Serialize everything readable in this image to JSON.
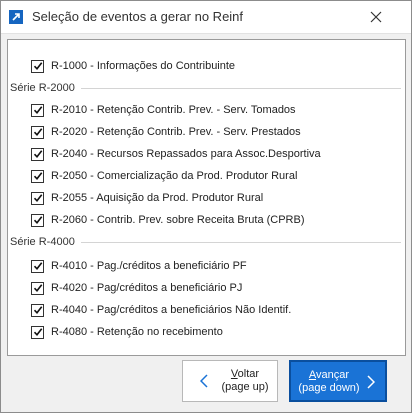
{
  "window": {
    "title": "Seleção de eventos a gerar no Reinf"
  },
  "events": {
    "r1000": {
      "label": "R-1000 - Informações do Contribuinte",
      "checked": true
    },
    "serie2000": {
      "label": "Série R-2000",
      "items": [
        {
          "label": "R-2010 - Retenção Contrib. Prev. - Serv. Tomados",
          "checked": true
        },
        {
          "label": "R-2020 - Retenção Contrib. Prev. - Serv. Prestados",
          "checked": true
        },
        {
          "label": "R-2040 - Recursos Repassados para Assoc.Desportiva",
          "checked": true
        },
        {
          "label": "R-2050 - Comercialização da Prod. Produtor Rural",
          "checked": true
        },
        {
          "label": "R-2055 - Aquisição da Prod. Produtor Rural",
          "checked": true
        },
        {
          "label": "R-2060 - Contrib. Prev. sobre Receita Bruta (CPRB)",
          "checked": true
        }
      ]
    },
    "serie4000": {
      "label": "Série R-4000",
      "items": [
        {
          "label": "R-4010 - Pag./créditos a beneficiário PF",
          "checked": true
        },
        {
          "label": "R-4020 - Pag/créditos a beneficiário PJ",
          "checked": true
        },
        {
          "label": "R-4040 - Pag/créditos a beneficiários Não Identif.",
          "checked": true
        },
        {
          "label": "R-4080 - Retenção no recebimento",
          "checked": true
        }
      ]
    }
  },
  "footer": {
    "back": {
      "label": "Voltar",
      "underline_char": "V",
      "label_rest": "oltar",
      "hint": "(page up)"
    },
    "next": {
      "label": "Avançar",
      "underline_char": "A",
      "label_rest": "vançar",
      "hint": "(page down)"
    }
  },
  "colors": {
    "accent": "#1a73d6",
    "accent_border": "#0a4f9e",
    "title_icon": "#1565c0"
  },
  "icons": {
    "app": "external-link-arrow-icon",
    "close": "close-icon",
    "back": "chevron-left-icon",
    "next": "chevron-right-icon",
    "check": "checkmark-icon"
  }
}
